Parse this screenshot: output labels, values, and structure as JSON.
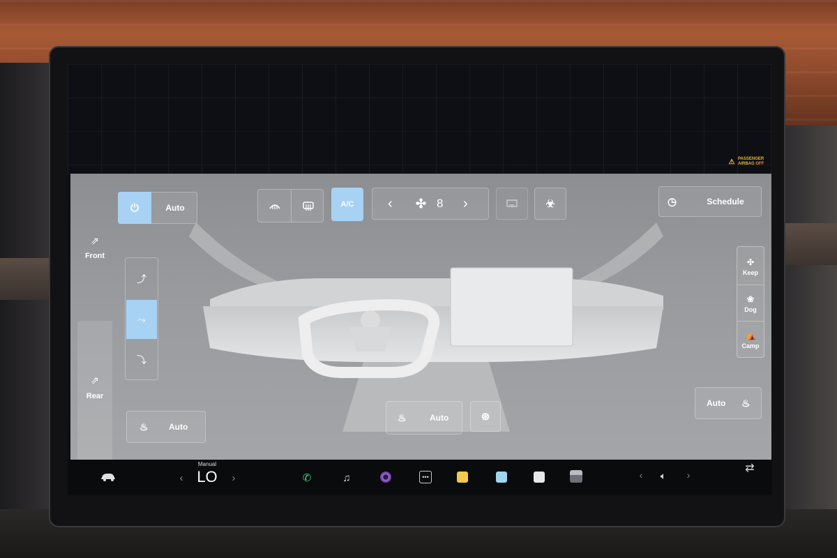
{
  "status": {
    "airbag_line1": "PASSENGER",
    "airbag_line2": "AIRBAG",
    "airbag_line3": "OFF"
  },
  "climate": {
    "power_icon": "power-icon",
    "auto_label": "Auto",
    "front_defrost_icon": "front-defrost-icon",
    "rear_defrost_icon": "rear-defrost-icon",
    "ac_label": "A/C",
    "fan": {
      "prev_label": "‹",
      "next_label": "›",
      "speed": "8",
      "icon": "fan-icon"
    },
    "recirculate_icon": "recirculate-icon",
    "bioweapon_icon": "biohazard-icon",
    "schedule_label": "Schedule",
    "schedule_icon": "clock-icon",
    "front_label": "Front",
    "rear_label": "Rear",
    "vent_modes": [
      "upper-vent-icon",
      "face-vent-icon",
      "floor-vent-icon"
    ],
    "keep_label": "Keep",
    "dog_label": "Dog",
    "camp_label": "Camp",
    "seat_heat_left_label": "Auto",
    "seat_heat_center_label": "Auto",
    "seat_heat_right_label": "Auto",
    "wheel_heat_icon": "steering-wheel-heat-icon",
    "accent": "#a8d2f4",
    "panel_bg": "#999b9e"
  },
  "taskbar": {
    "car_icon": "car-icon",
    "temp_mode_label": "Manual",
    "temp_value": "LO",
    "temp_prev": "‹",
    "temp_next": "›",
    "apps": [
      "phone-icon",
      "music-icon",
      "camera-icon",
      "more-apps-icon",
      "app-yellow-icon",
      "app-blue-icon",
      "app-white-icon",
      "app-gray-icon"
    ],
    "vol_prev": "‹",
    "vol_next": "›",
    "volume_icon": "volume-icon",
    "swap_icon": "swap-icon"
  }
}
